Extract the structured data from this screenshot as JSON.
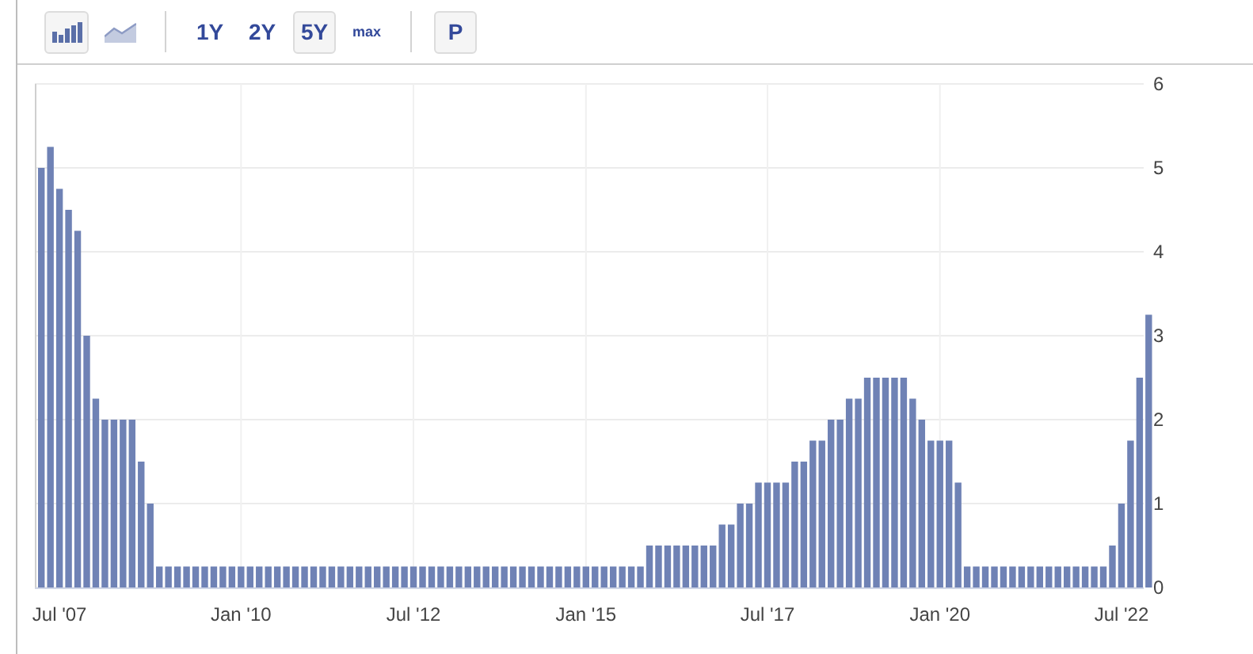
{
  "toolbar": {
    "chart_types": [
      {
        "kind": "bar",
        "selected": true
      },
      {
        "kind": "line",
        "selected": false
      }
    ],
    "ranges": [
      {
        "label": "1Y",
        "selected": false
      },
      {
        "label": "2Y",
        "selected": false
      },
      {
        "label": "5Y",
        "selected": true
      },
      {
        "label": "max",
        "selected": false
      }
    ],
    "extra": [
      {
        "label": "P",
        "selected": true
      }
    ]
  },
  "chart": {
    "chart_data": {
      "type": "bar",
      "color": "#6f82b5",
      "grid": true,
      "ylim": [
        0,
        6
      ],
      "yticks": [
        0,
        1,
        2,
        3,
        4,
        5,
        6
      ],
      "categories": [
        null,
        null,
        "Jul '07",
        null,
        null,
        null,
        null,
        null,
        null,
        null,
        null,
        null,
        null,
        null,
        null,
        null,
        null,
        null,
        null,
        null,
        null,
        null,
        "Jan '10",
        null,
        null,
        null,
        null,
        null,
        null,
        null,
        null,
        null,
        null,
        null,
        null,
        null,
        null,
        null,
        null,
        null,
        null,
        "Jul '12",
        null,
        null,
        null,
        null,
        null,
        null,
        null,
        null,
        null,
        null,
        null,
        null,
        null,
        null,
        null,
        null,
        null,
        null,
        "Jan '15",
        null,
        null,
        null,
        null,
        null,
        null,
        null,
        null,
        null,
        null,
        null,
        null,
        null,
        null,
        null,
        null,
        null,
        null,
        null,
        "Jul '17",
        null,
        null,
        null,
        null,
        null,
        null,
        null,
        null,
        null,
        null,
        null,
        null,
        null,
        null,
        null,
        null,
        null,
        null,
        "Jan '20",
        null,
        null,
        null,
        null,
        null,
        null,
        null,
        null,
        null,
        null,
        null,
        null,
        null,
        null,
        null,
        null,
        null,
        null,
        null,
        "Jul '22",
        null,
        null,
        null
      ],
      "values": [
        5.0,
        5.25,
        4.75,
        4.5,
        4.25,
        3.0,
        2.25,
        2.0,
        2.0,
        2.0,
        2.0,
        1.5,
        1.0,
        0.25,
        0.25,
        0.25,
        0.25,
        0.25,
        0.25,
        0.25,
        0.25,
        0.25,
        0.25,
        0.25,
        0.25,
        0.25,
        0.25,
        0.25,
        0.25,
        0.25,
        0.25,
        0.25,
        0.25,
        0.25,
        0.25,
        0.25,
        0.25,
        0.25,
        0.25,
        0.25,
        0.25,
        0.25,
        0.25,
        0.25,
        0.25,
        0.25,
        0.25,
        0.25,
        0.25,
        0.25,
        0.25,
        0.25,
        0.25,
        0.25,
        0.25,
        0.25,
        0.25,
        0.25,
        0.25,
        0.25,
        0.25,
        0.25,
        0.25,
        0.25,
        0.25,
        0.25,
        0.25,
        0.5,
        0.5,
        0.5,
        0.5,
        0.5,
        0.5,
        0.5,
        0.5,
        0.75,
        0.75,
        1.0,
        1.0,
        1.25,
        1.25,
        1.25,
        1.25,
        1.5,
        1.5,
        1.75,
        1.75,
        2.0,
        2.0,
        2.25,
        2.25,
        2.5,
        2.5,
        2.5,
        2.5,
        2.5,
        2.25,
        2.0,
        1.75,
        1.75,
        1.75,
        1.25,
        0.25,
        0.25,
        0.25,
        0.25,
        0.25,
        0.25,
        0.25,
        0.25,
        0.25,
        0.25,
        0.25,
        0.25,
        0.25,
        0.25,
        0.25,
        0.25,
        0.5,
        1.0,
        1.75,
        2.5,
        3.25
      ]
    }
  }
}
